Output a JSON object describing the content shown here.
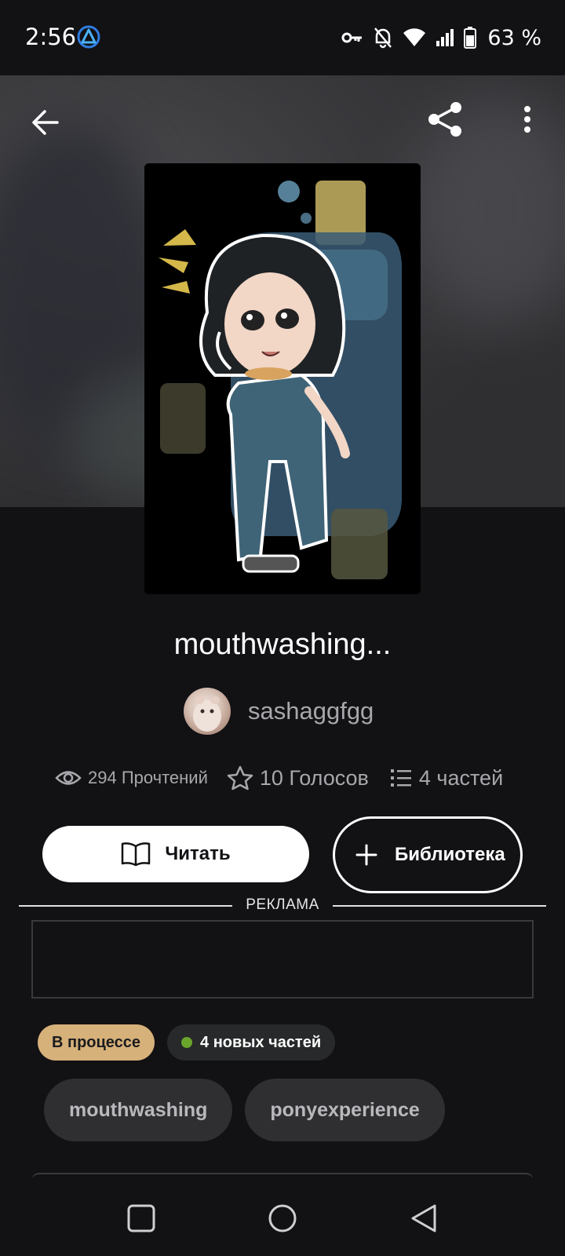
{
  "status_bar": {
    "time": "2:56",
    "battery": "63 %",
    "icons": [
      "app-notification-icon",
      "vpn-key-icon",
      "notifications-off-icon",
      "wifi-icon",
      "signal-icon",
      "battery-icon"
    ]
  },
  "toolbar": {
    "icons": [
      "back-arrow-icon",
      "share-icon",
      "more-vertical-icon"
    ]
  },
  "story": {
    "title": "mouthwashing...",
    "author": "sashaggfgg",
    "reads": "294 Прочтений",
    "votes": "10 Голосов",
    "parts": "4 частей"
  },
  "actions": {
    "read_label": "Читать",
    "library_label": "Библиотека"
  },
  "ad": {
    "label": "РЕКЛАМА"
  },
  "badges": {
    "status": "В процессе",
    "new_parts": "4 новых частей"
  },
  "tags": [
    "mouthwashing",
    "ponyexperience"
  ],
  "colors": {
    "background": "#121114",
    "status_badge": "#d6b17a",
    "new_parts_dot": "#6aa52c",
    "tag_bg": "#2f2f32"
  }
}
